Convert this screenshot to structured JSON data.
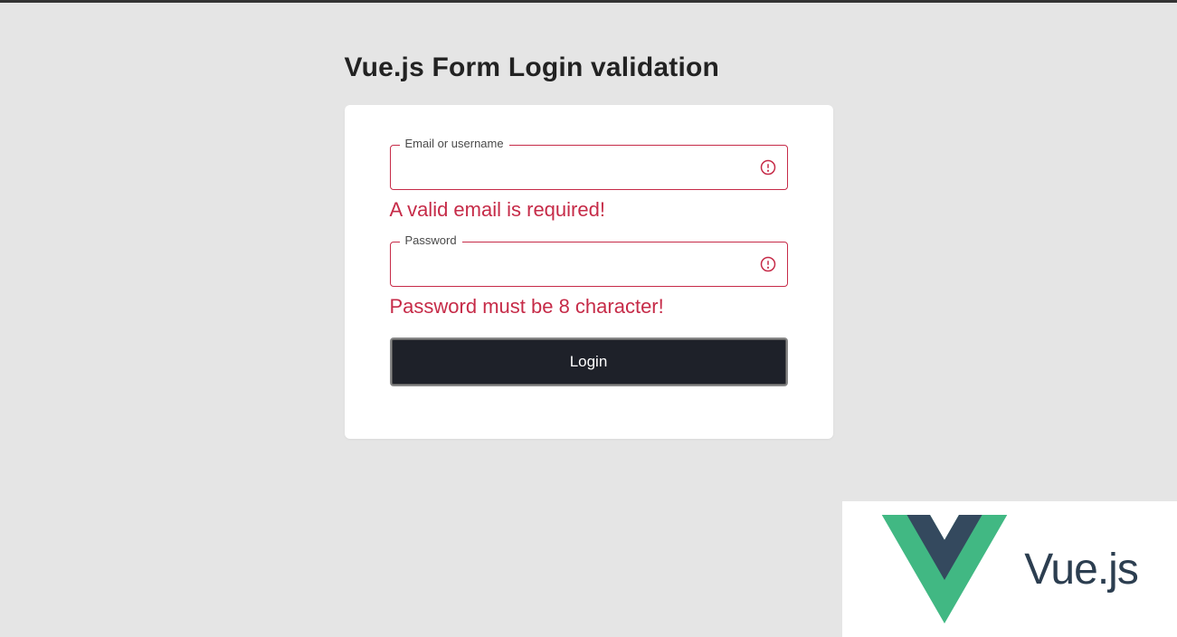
{
  "page": {
    "title": "Vue.js Form Login validation"
  },
  "form": {
    "email": {
      "label": "Email or username",
      "value": "",
      "error": "A valid email is required!"
    },
    "password": {
      "label": "Password",
      "value": "",
      "error": "Password must be 8 character!"
    },
    "submit_label": "Login"
  },
  "branding": {
    "name": "Vue.js",
    "colors": {
      "outer": "#41b883",
      "inner": "#35495e",
      "error": "#c62b48",
      "button": "#1e2129"
    }
  }
}
